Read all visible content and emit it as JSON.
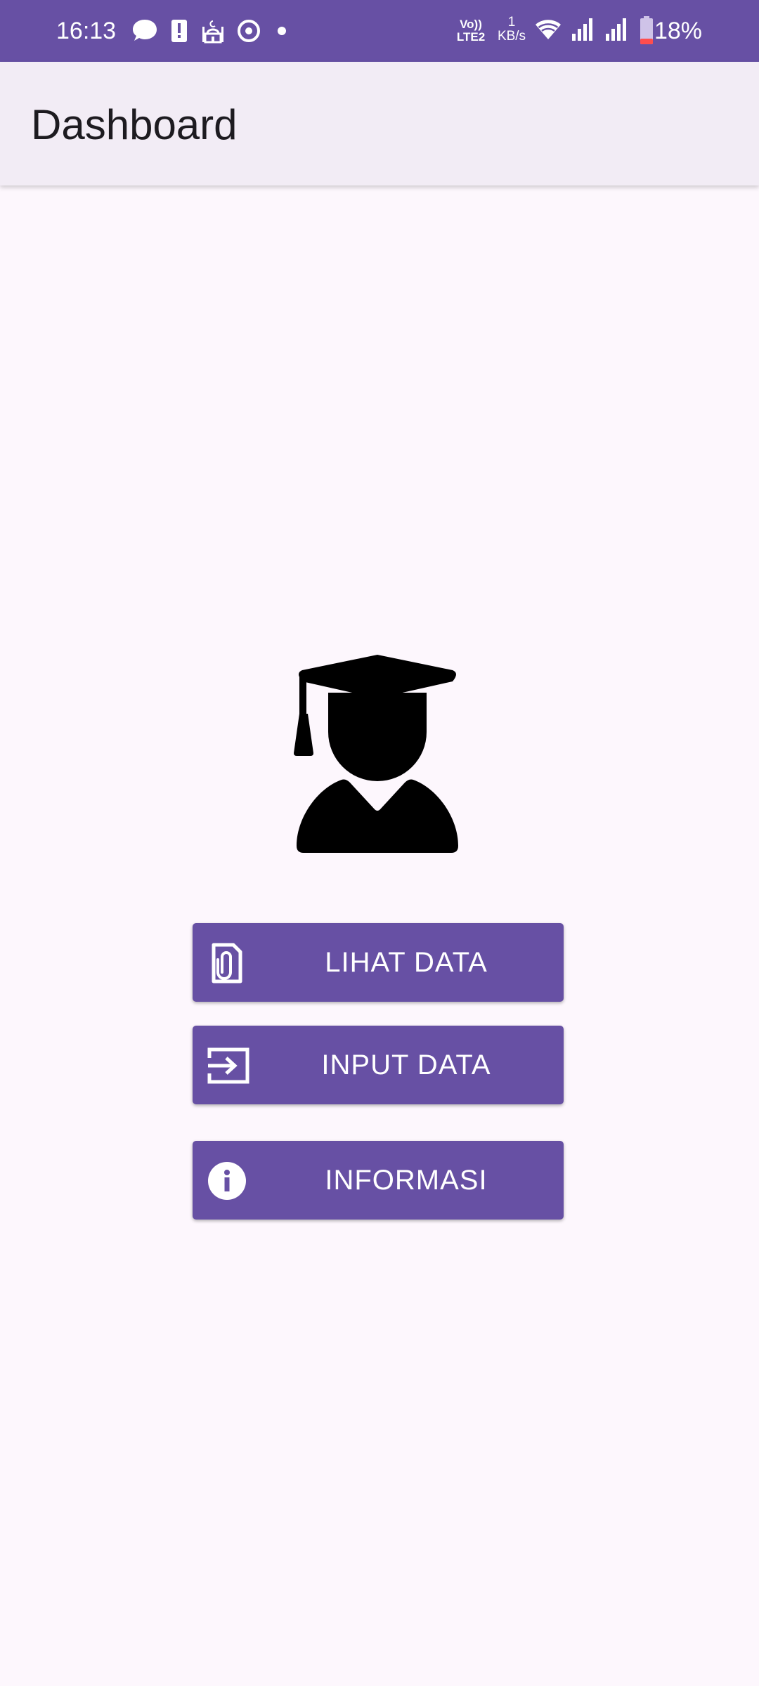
{
  "status_bar": {
    "time": "16:13",
    "left_icons": [
      "chat-bubble-icon",
      "alert-icon",
      "mosque-icon",
      "location-app-icon",
      "dot-icon"
    ],
    "network_type_top": "Vo))",
    "network_type_bottom": "LTE2",
    "speed_value": "1",
    "speed_unit": "KB/s",
    "right_icons": [
      "wifi-icon",
      "signal-icon",
      "signal-icon",
      "battery-icon"
    ],
    "battery_percent": "18%",
    "background": "#6750a4"
  },
  "app_bar": {
    "title": "Dashboard",
    "background": "#f2ecf5"
  },
  "hero": {
    "icon": "graduate-icon"
  },
  "buttons": [
    {
      "label": "LIHAT DATA",
      "icon": "document-attachment-icon"
    },
    {
      "label": "INPUT DATA",
      "icon": "input-icon"
    },
    {
      "label": "INFORMASI",
      "icon": "info-icon"
    }
  ],
  "colors": {
    "primary": "#6750a4",
    "background": "#fdf7fd",
    "on_primary": "#ffffff"
  }
}
